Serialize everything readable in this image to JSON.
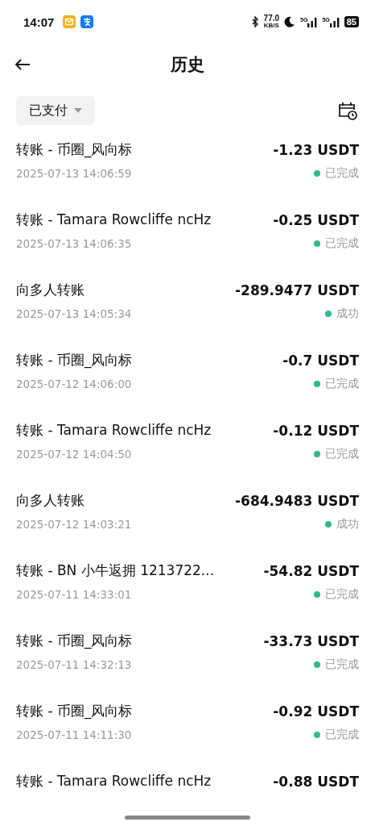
{
  "status_bar": {
    "time": "14:07",
    "speed": "77.0",
    "speed_unit": "KB/S",
    "signal_1": "5G",
    "signal_2": "5G",
    "battery": "85"
  },
  "header": {
    "title": "历史"
  },
  "filter": {
    "label": "已支付"
  },
  "transactions": [
    {
      "title": "转账 - 币圈_风向标",
      "amount": "-1.23 USDT",
      "time": "2025-07-13 14:06:59",
      "status": "已完成"
    },
    {
      "title": "转账 - Tamara Rowcliffe ncHz",
      "amount": "-0.25 USDT",
      "time": "2025-07-13 14:06:35",
      "status": "已完成"
    },
    {
      "title": "向多人转账",
      "amount": "-289.9477 USDT",
      "time": "2025-07-13 14:05:34",
      "status": "成功"
    },
    {
      "title": "转账 - 币圈_风向标",
      "amount": "-0.7 USDT",
      "time": "2025-07-12 14:06:00",
      "status": "已完成"
    },
    {
      "title": "转账 - Tamara Rowcliffe ncHz",
      "amount": "-0.12 USDT",
      "time": "2025-07-12 14:04:50",
      "status": "已完成"
    },
    {
      "title": "向多人转账",
      "amount": "-684.9483 USDT",
      "time": "2025-07-12 14:03:21",
      "status": "成功"
    },
    {
      "title": "转账 - BN 小牛返拥 1213722...",
      "amount": "-54.82 USDT",
      "time": "2025-07-11 14:33:01",
      "status": "已完成"
    },
    {
      "title": "转账 - 币圈_风向标",
      "amount": "-33.73 USDT",
      "time": "2025-07-11 14:32:13",
      "status": "已完成"
    },
    {
      "title": "转账 - 币圈_风向标",
      "amount": "-0.92 USDT",
      "time": "2025-07-11 14:11:30",
      "status": "已完成"
    },
    {
      "title": "转账 - Tamara Rowcliffe ncHz",
      "amount": "-0.88 USDT"
    }
  ]
}
